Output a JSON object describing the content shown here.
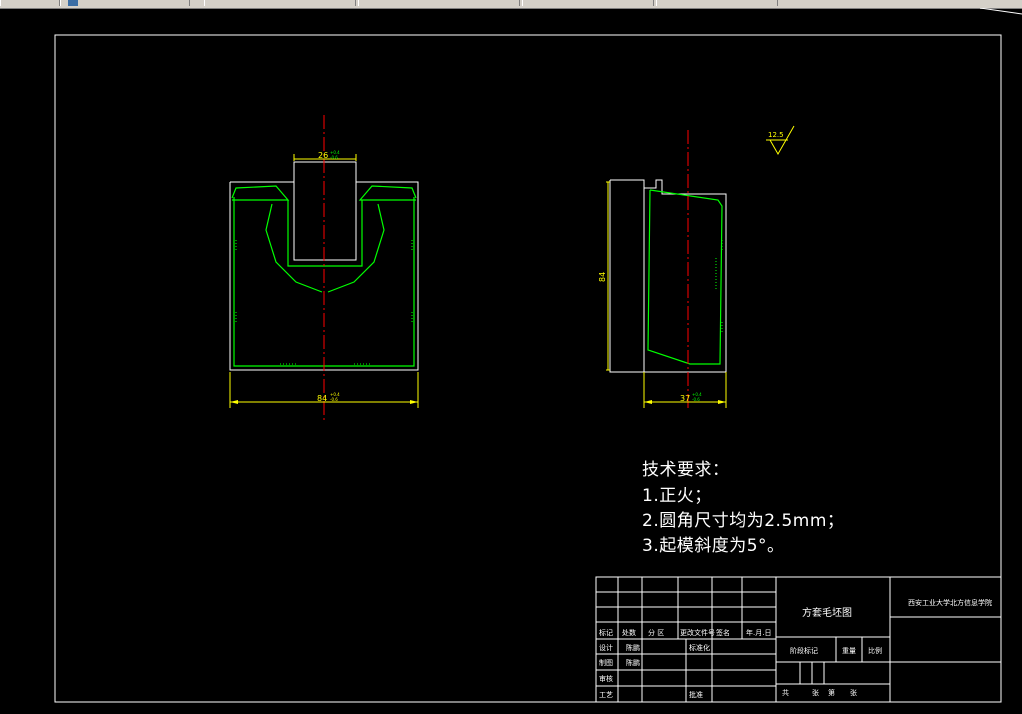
{
  "window": {
    "toolbar": {
      "icon": "app-icon"
    }
  },
  "drawing": {
    "colors": {
      "background": "#000000",
      "outline": "#ffffff",
      "part": "#00ff00",
      "centerline": "#ff0000",
      "dimension": "#ffff00"
    },
    "dimensions": {
      "top_width": "26",
      "front_width": "84",
      "side_height": "84",
      "side_width": "37",
      "tol_upper": "+0.4",
      "tol_lower": "-0.6"
    },
    "roughness": "12.5",
    "tech_requirements": {
      "title": "技术要求：",
      "items": [
        "1.正火；",
        "2.圆角尺寸均为2.5mm；",
        "3.起模斜度为5°。"
      ]
    },
    "title_block": {
      "drawing_name": "方套毛坯图",
      "school": "西安工业大学北方信息学院",
      "rev_headers": [
        "标记",
        "处数",
        "分 区",
        "更改文件号",
        "签名",
        "年.月.日"
      ],
      "design_label": "设计",
      "design_name": "陈鹏",
      "standardize_label": "标准化",
      "drafting_label": "制图",
      "drafting_name": "陈鹏",
      "review_label": "审核",
      "process_label": "工艺",
      "approve_label": "批准",
      "stage_label": "阶段标记",
      "weight_label": "重量",
      "scale_label": "比例",
      "total_label": "共",
      "sheets_label": "张",
      "sheet_label": "第",
      "page_label": "张"
    }
  }
}
